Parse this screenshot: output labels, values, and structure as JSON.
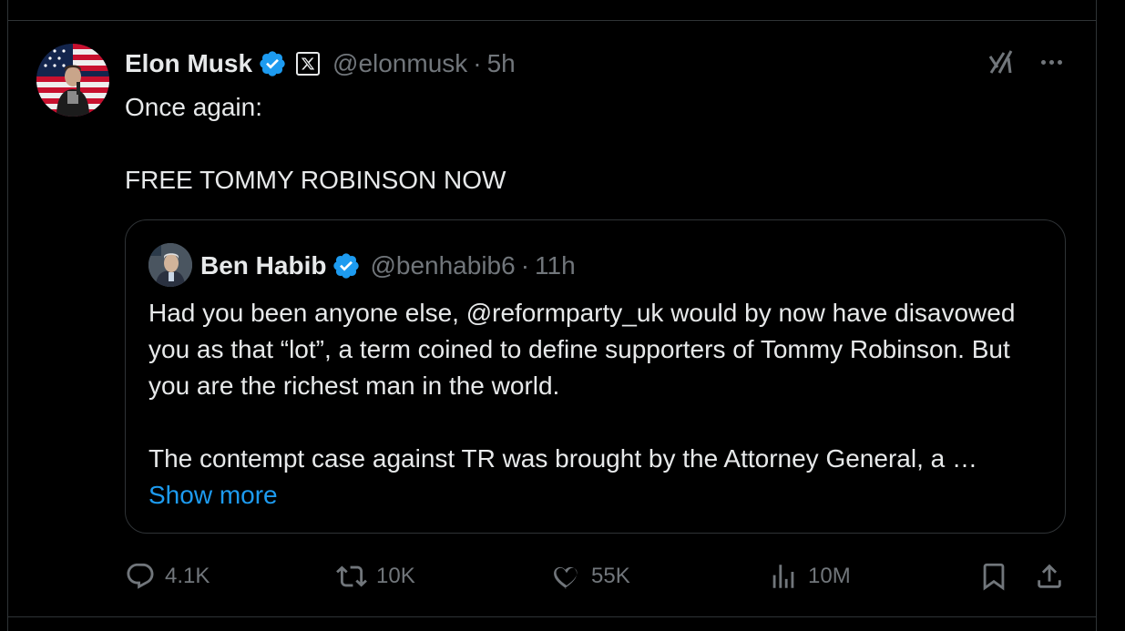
{
  "post": {
    "author_name": "Elon Musk",
    "handle": "@elonmusk",
    "separator": "·",
    "time": "5h",
    "text": "Once again:\n\nFREE TOMMY ROBINSON NOW",
    "affiliate_badge": "X"
  },
  "quote": {
    "author_name": "Ben Habib",
    "handle": "@benhabib6",
    "separator": "·",
    "time": "11h",
    "text": "Had you been anyone else, @reformparty_uk would by now have disavowed you as that “lot”, a term coined to define supporters of Tommy Robinson. But you are the richest man in the world.\n\nThe contempt case against TR was brought by the Attorney General, a …",
    "show_more": "Show more"
  },
  "actions": {
    "replies": "4.1K",
    "reposts": "10K",
    "likes": "55K",
    "views": "10M"
  },
  "colors": {
    "background": "#000000",
    "text": "#e7e9ea",
    "muted": "#71767b",
    "accent": "#1d9bf0",
    "border": "#2f3336"
  },
  "icons": {
    "verified": "verified-badge-icon",
    "grok": "grok-icon",
    "more": "more-icon",
    "reply": "reply-icon",
    "repost": "repost-icon",
    "like": "like-icon",
    "views": "views-icon",
    "bookmark": "bookmark-icon",
    "share": "share-icon"
  }
}
